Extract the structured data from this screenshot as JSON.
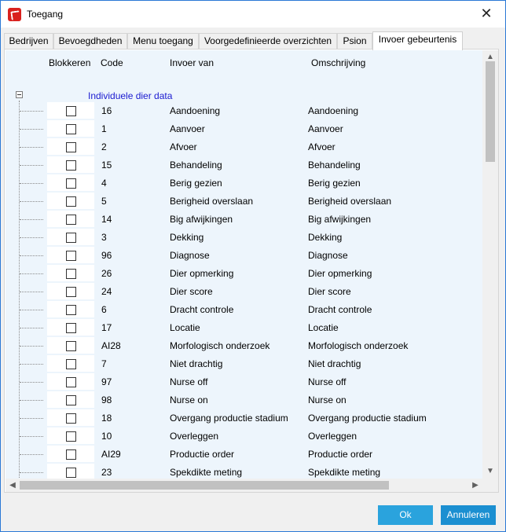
{
  "window": {
    "title": "Toegang",
    "close_glyph": "✕"
  },
  "tabs": [
    {
      "label": "Bedrijven"
    },
    {
      "label": "Bevoegdheden"
    },
    {
      "label": "Menu toegang"
    },
    {
      "label": "Voorgedefinieerde overzichten"
    },
    {
      "label": "Psion"
    },
    {
      "label": "Invoer gebeurtenis"
    }
  ],
  "active_tab": "Invoer gebeurtenis",
  "columns": {
    "blokkeren": "Blokkeren",
    "code": "Code",
    "invoer": "Invoer van",
    "omschrijving": "Omschrijving"
  },
  "group": {
    "label": "Individuele dier data",
    "expanded": true
  },
  "rows": [
    {
      "code": "16",
      "invoer": "Aandoening",
      "oms": "Aandoening",
      "blocked": false
    },
    {
      "code": "1",
      "invoer": "Aanvoer",
      "oms": "Aanvoer",
      "blocked": false
    },
    {
      "code": "2",
      "invoer": "Afvoer",
      "oms": "Afvoer",
      "blocked": false
    },
    {
      "code": "15",
      "invoer": "Behandeling",
      "oms": "Behandeling",
      "blocked": false
    },
    {
      "code": "4",
      "invoer": "Berig gezien",
      "oms": "Berig gezien",
      "blocked": false
    },
    {
      "code": "5",
      "invoer": "Berigheid overslaan",
      "oms": "Berigheid overslaan",
      "blocked": false
    },
    {
      "code": "14",
      "invoer": "Big afwijkingen",
      "oms": "Big afwijkingen",
      "blocked": false
    },
    {
      "code": "3",
      "invoer": "Dekking",
      "oms": "Dekking",
      "blocked": false
    },
    {
      "code": "96",
      "invoer": "Diagnose",
      "oms": "Diagnose",
      "blocked": false
    },
    {
      "code": "26",
      "invoer": "Dier opmerking",
      "oms": "Dier opmerking",
      "blocked": false
    },
    {
      "code": "24",
      "invoer": "Dier score",
      "oms": "Dier score",
      "blocked": false
    },
    {
      "code": "6",
      "invoer": "Dracht controle",
      "oms": "Dracht controle",
      "blocked": false
    },
    {
      "code": "17",
      "invoer": "Locatie",
      "oms": "Locatie",
      "blocked": false
    },
    {
      "code": "AI28",
      "invoer": "Morfologisch onderzoek",
      "oms": "Morfologisch onderzoek",
      "blocked": false
    },
    {
      "code": "7",
      "invoer": "Niet drachtig",
      "oms": "Niet drachtig",
      "blocked": false
    },
    {
      "code": "97",
      "invoer": "Nurse off",
      "oms": "Nurse off",
      "blocked": false
    },
    {
      "code": "98",
      "invoer": "Nurse on",
      "oms": "Nurse on",
      "blocked": false
    },
    {
      "code": "18",
      "invoer": "Overgang productie stadium",
      "oms": "Overgang productie stadium",
      "blocked": false
    },
    {
      "code": "10",
      "invoer": "Overleggen",
      "oms": "Overleggen",
      "blocked": false
    },
    {
      "code": "AI29",
      "invoer": "Productie order",
      "oms": "Productie order",
      "blocked": false
    },
    {
      "code": "23",
      "invoer": "Spekdikte meting",
      "oms": "Spekdikte meting",
      "blocked": false
    }
  ],
  "buttons": {
    "ok": "Ok",
    "cancel": "Annuleren"
  },
  "colors": {
    "accent": "#2aa3dd",
    "grid_bg": "#edf5fc",
    "group_text": "#1a1ad0",
    "app_icon": "#d9211e"
  },
  "scrollbars": {
    "vertical_glyphs": [
      "▲",
      "▼"
    ],
    "horizontal_glyphs": [
      "◀",
      "▶"
    ]
  }
}
